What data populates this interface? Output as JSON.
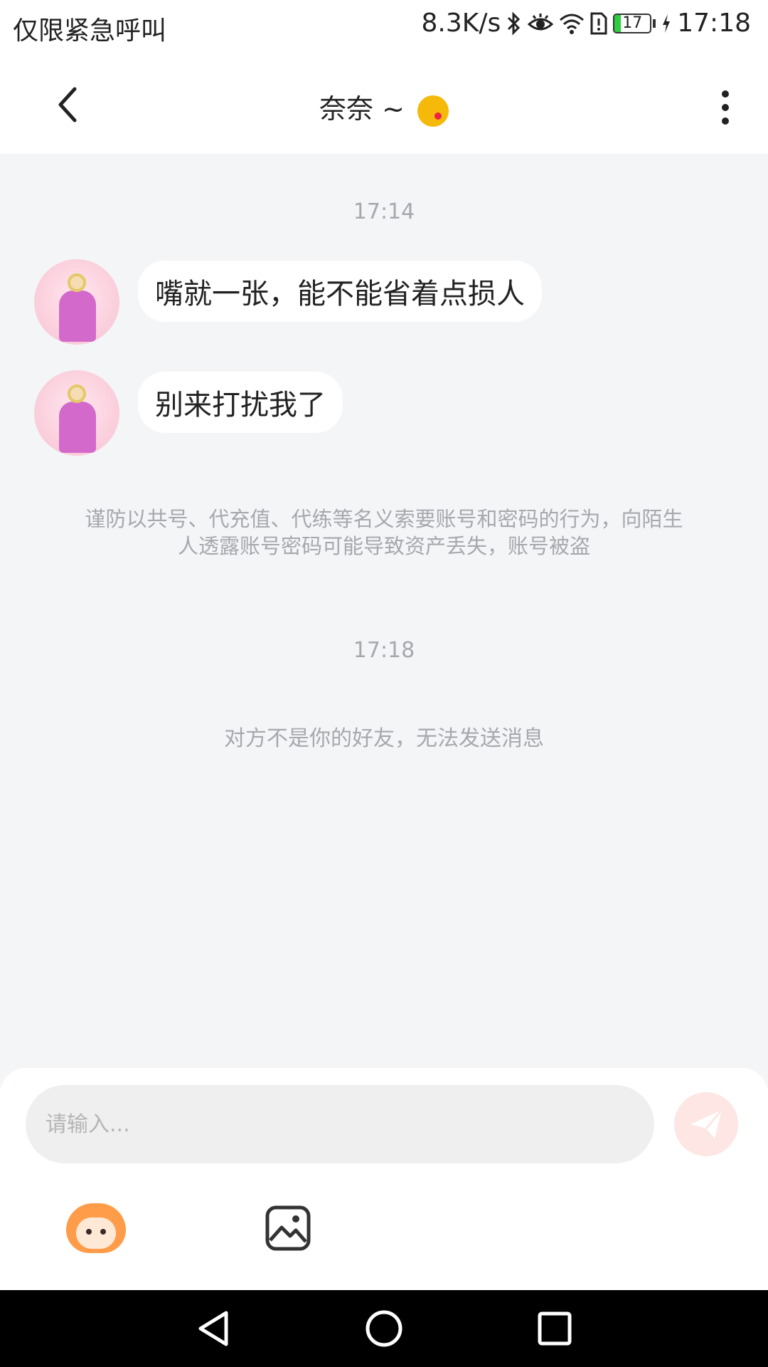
{
  "status_bar": {
    "carrier": "仅限紧急呼叫",
    "speed": "8.3K/s",
    "battery": "17",
    "battery_level": 0.17,
    "time": "17:18",
    "icons": [
      "bluetooth-icon",
      "eye-icon",
      "wifi-icon",
      "sim-alert-icon",
      "battery-icon",
      "charging-icon"
    ]
  },
  "header": {
    "title": "奈奈 ~",
    "title_emoji": "kissing-face-emoji",
    "back_icon": "chevron-left-icon",
    "more_icon": "more-vertical-icon"
  },
  "chat": {
    "time_1": "17:14",
    "messages": [
      {
        "text": "嘴就一张，能不能省着点损人"
      },
      {
        "text": "别来打扰我了"
      }
    ],
    "notice_line1": "谨防以共号、代充值、代练等名义索要账号和密码的行为，向陌生",
    "notice_line2": "人透露账号密码可能导致资产丢失，账号被盗",
    "time_2": "17:18",
    "system_message": "对方不是你的好友，无法发送消息"
  },
  "input": {
    "placeholder": "请输入...",
    "send_icon": "send-icon",
    "toolbar": [
      "mascot-sticker-icon",
      "image-icon"
    ]
  },
  "colors": {
    "background": "#f4f5f7",
    "bubble": "#ffffff",
    "muted_text": "#a6a8ad",
    "send_button": "#fde6e4",
    "send_icon": "#ffffff"
  }
}
